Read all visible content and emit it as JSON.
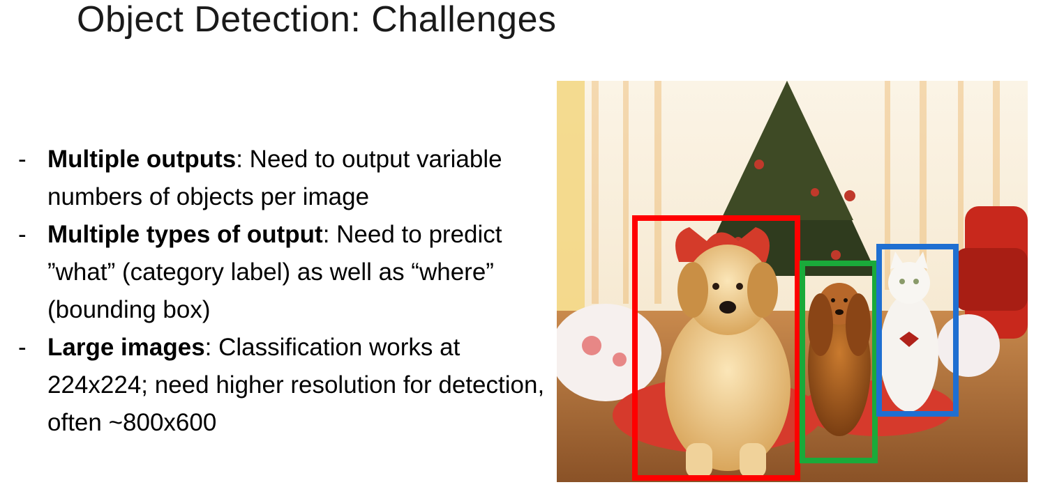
{
  "slide": {
    "title": "Object Detection: Challenges",
    "bullets": [
      {
        "marker": "-",
        "term": "Multiple outputs",
        "text": ": Need to output variable numbers of objects per image"
      },
      {
        "marker": "-",
        "term": "Multiple types of output",
        "text": ": Need to predict ”what” (category label) as well as “where” (bounding box)"
      },
      {
        "marker": "-",
        "term": "Large images",
        "text": ": Classification works at 224x224; need higher resolution for detection, often ~800x600"
      }
    ]
  },
  "photo": {
    "subjects": [
      "golden-retriever",
      "cocker-spaniel",
      "white-cat",
      "christmas-tree"
    ],
    "box_colors": {
      "dog_1": "#ff0000",
      "dog_2": "#1aaa3a",
      "cat": "#1f6fd1"
    }
  }
}
